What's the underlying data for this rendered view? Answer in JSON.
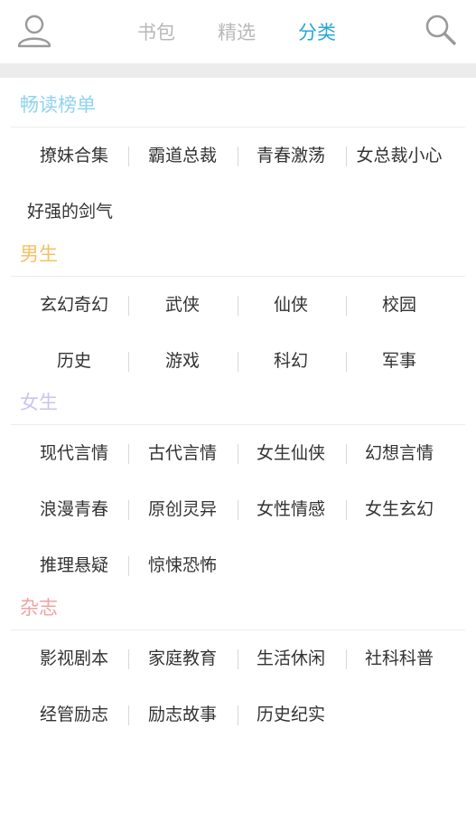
{
  "header": {
    "tabs": [
      {
        "label": "书包"
      },
      {
        "label": "精选"
      },
      {
        "label": "分类"
      }
    ],
    "active_tab": "分类",
    "accent_color": "#2aa5d6",
    "left_icon": "user-icon",
    "right_icon": "search-icon"
  },
  "sections": [
    {
      "title": "畅读榜单",
      "title_color": "#8fd3f0",
      "rows": [
        [
          "撩妹合集",
          "霸道总裁",
          "青春激荡",
          "女总裁小心"
        ],
        [
          "好强的剑气"
        ]
      ]
    },
    {
      "title": "男生",
      "title_color": "#f5c063",
      "rows": [
        [
          "玄幻奇幻",
          "武侠",
          "仙侠",
          "校园"
        ],
        [
          "历史",
          "游戏",
          "科幻",
          "军事"
        ]
      ]
    },
    {
      "title": "女生",
      "title_color": "#c9c6ee",
      "rows": [
        [
          "现代言情",
          "古代言情",
          "女生仙侠",
          "幻想言情"
        ],
        [
          "浪漫青春",
          "原创灵异",
          "女性情感",
          "女生玄幻"
        ],
        [
          "推理悬疑",
          "惊悚恐怖"
        ]
      ]
    },
    {
      "title": "杂志",
      "title_color": "#f2a1a1",
      "rows": [
        [
          "影视剧本",
          "家庭教育",
          "生活休闲",
          "社科科普"
        ],
        [
          "经管励志",
          "励志故事",
          "历史纪实"
        ]
      ]
    }
  ]
}
